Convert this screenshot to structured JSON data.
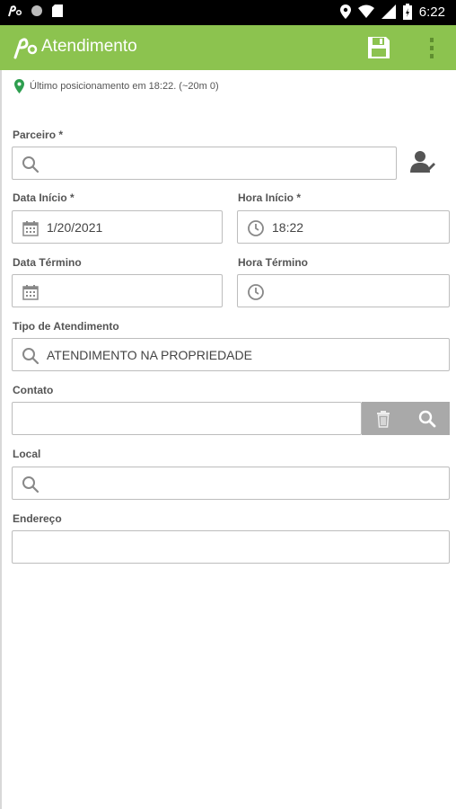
{
  "status_bar": {
    "time": "6:22",
    "icons": [
      "app-logo-icon",
      "circle-icon",
      "sd-card-icon",
      "location-icon",
      "wifi-icon",
      "signal-icon",
      "battery-icon"
    ]
  },
  "app_bar": {
    "title": "Atendimento",
    "color": "#8cc34f",
    "actions": [
      "save-icon",
      "more-vert-icon"
    ]
  },
  "location_info": "Último posicionamento em 18:22. (~20m 0)",
  "form": {
    "parceiro": {
      "label": "Parceiro *",
      "value": ""
    },
    "data_inicio": {
      "label": "Data Início *",
      "value": "1/20/2021"
    },
    "hora_inicio": {
      "label": "Hora Início *",
      "value": "18:22"
    },
    "data_termino": {
      "label": "Data Término",
      "value": ""
    },
    "hora_termino": {
      "label": "Hora Término",
      "value": ""
    },
    "tipo_atendimento": {
      "label": "Tipo de Atendimento",
      "value": "ATENDIMENTO NA PROPRIEDADE"
    },
    "contato": {
      "label": "Contato",
      "value": ""
    },
    "local": {
      "label": "Local",
      "value": ""
    },
    "endereco": {
      "label": "Endereço",
      "value": ""
    }
  }
}
